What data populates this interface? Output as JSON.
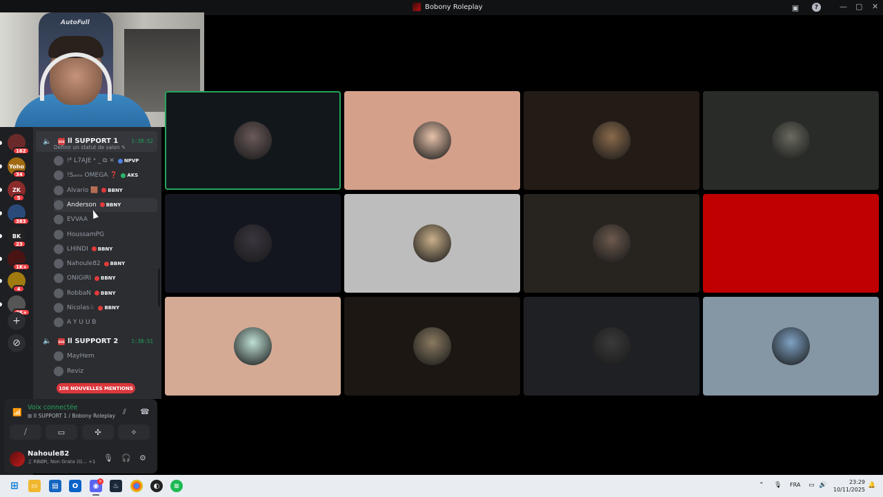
{
  "window": {
    "title": "Bobony Roleplay",
    "controls": [
      "—",
      "▢",
      "✕"
    ]
  },
  "webcam": {
    "chair_text": "AutoFull"
  },
  "servers": [
    {
      "label": "",
      "badge": "162",
      "color": "#6b2a2a"
    },
    {
      "label": "Yoho",
      "badge": "34",
      "color": "#a06b12"
    },
    {
      "label": "ZK",
      "badge": "5",
      "color": "#8b2b2b"
    },
    {
      "label": "",
      "badge": "383",
      "color": "#2a4a7a"
    },
    {
      "label": "BK",
      "badge": "23",
      "color": "#222"
    },
    {
      "label": "",
      "badge": "1K+",
      "color": "#4a1414"
    },
    {
      "label": "",
      "badge": "4",
      "color": "#a07b10"
    },
    {
      "label": "",
      "badge": "2K+",
      "color": "#555"
    }
  ],
  "channel1": {
    "name": "SUPPORT 1",
    "timer": "1:38:52",
    "status_hint": "Définir un statut de salon ✎",
    "members": [
      {
        "name": "!ᴷ L7AJE ᵃ _ ⧉ ✕",
        "tag": "NPVP",
        "tag_color": "blue"
      },
      {
        "name": "!Sₐₙₜₒ OMEGA ❓",
        "tag": "AKS",
        "tag_color": "green"
      },
      {
        "name": "Alvario 🟫",
        "tag": "BBNY",
        "tag_color": "red"
      },
      {
        "name": "Anderson",
        "tag": "BBNY",
        "tag_color": "red"
      },
      {
        "name": "EVVAA",
        "tag": "",
        "tag_color": ""
      },
      {
        "name": "HoussamPG",
        "tag": "",
        "tag_color": ""
      },
      {
        "name": "LHINDI",
        "tag": "BBNY",
        "tag_color": "red"
      },
      {
        "name": "Nahoule82",
        "tag": "BBNY",
        "tag_color": "red"
      },
      {
        "name": "ONIGIRI",
        "tag": "BBNY",
        "tag_color": "red"
      },
      {
        "name": "RobbaN",
        "tag": "BBNY",
        "tag_color": "red"
      },
      {
        "name": "Nicolas♧",
        "tag": "BBNY",
        "tag_color": "red"
      },
      {
        "name": "A Y U U B",
        "tag": "",
        "tag_color": ""
      }
    ]
  },
  "channel2": {
    "name": "SUPPORT 2",
    "timer": "1:38:51",
    "members": [
      {
        "name": "MayHem"
      },
      {
        "name": "Reviz"
      }
    ]
  },
  "mentions_pill": "106 NOUVELLES MENTIONS",
  "voice": {
    "title": "Voix connectée",
    "subtitle": "⊞ II SUPPORT 1 / Bobony Roleplay"
  },
  "user": {
    "name": "Nahoule82",
    "status": "♫ RBØR, Non Grata (G... +1"
  },
  "tiles": [
    {
      "bg": "#12171c",
      "avatar": "#6b5a5a",
      "speaking": true
    },
    {
      "bg": "#d4a08a",
      "avatar": "#e7c2aa",
      "speaking": false
    },
    {
      "bg": "#231b16",
      "avatar": "#8a6a4a",
      "speaking": false
    },
    {
      "bg": "#282b27",
      "avatar": "#6a6a60",
      "speaking": false
    },
    {
      "bg": "#14161f",
      "avatar": "#3a3640",
      "speaking": false
    },
    {
      "bg": "#bdbdbd",
      "avatar": "#c9b08a",
      "speaking": false
    },
    {
      "bg": "#27231f",
      "avatar": "#6d5a4e",
      "speaking": false
    },
    {
      "bg": "#c00000",
      "avatar": "#c00000",
      "speaking": false
    },
    {
      "bg": "#d4aa94",
      "avatar": "#bfe0d4",
      "speaking": false
    },
    {
      "bg": "#1c1712",
      "avatar": "#8a7a60",
      "speaking": false
    },
    {
      "bg": "#1f2024",
      "avatar": "#3a3a3a",
      "speaking": false
    },
    {
      "bg": "#8596a4",
      "avatar": "#7fa2c4",
      "speaking": false
    }
  ],
  "taskbar": {
    "tray_lang": "FRA",
    "time": "23:29",
    "date": "10/11/2025",
    "discord_badge": "9"
  }
}
